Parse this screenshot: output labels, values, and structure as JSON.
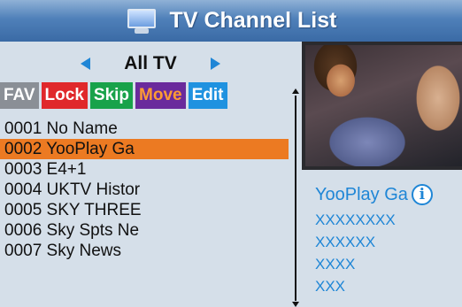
{
  "header": {
    "title": "TV Channel List",
    "icon": "tv-icon"
  },
  "group": {
    "label": "All TV"
  },
  "tabs": [
    {
      "label": "FAV",
      "color": "#8a8f96"
    },
    {
      "label": "Lock",
      "color": "#e0282b"
    },
    {
      "label": "Skip",
      "color": "#18a24a"
    },
    {
      "label": "Move",
      "color": "#6a2a9c"
    },
    {
      "label": "Edit",
      "color": "#1f92e0"
    }
  ],
  "channels": [
    {
      "label": "0001 No Name",
      "selected": false
    },
    {
      "label": "0002 YooPlay Ga",
      "selected": true
    },
    {
      "label": "0003 E4+1",
      "selected": false
    },
    {
      "label": "0004 UKTV Histor",
      "selected": false
    },
    {
      "label": "0005 SKY THREE",
      "selected": false
    },
    {
      "label": "0006 Sky Spts Ne",
      "selected": false
    },
    {
      "label": "0007 Sky News",
      "selected": false
    }
  ],
  "info": {
    "channel_name": "YooPlay Ga",
    "info_icon": "i",
    "lines": [
      "XXXXXXXX",
      "XXXXXX",
      "XXXX",
      "XXX"
    ]
  },
  "colors": {
    "accent": "#1f86d6",
    "selection": "#ec7a22",
    "background": "#d5dfe9"
  }
}
